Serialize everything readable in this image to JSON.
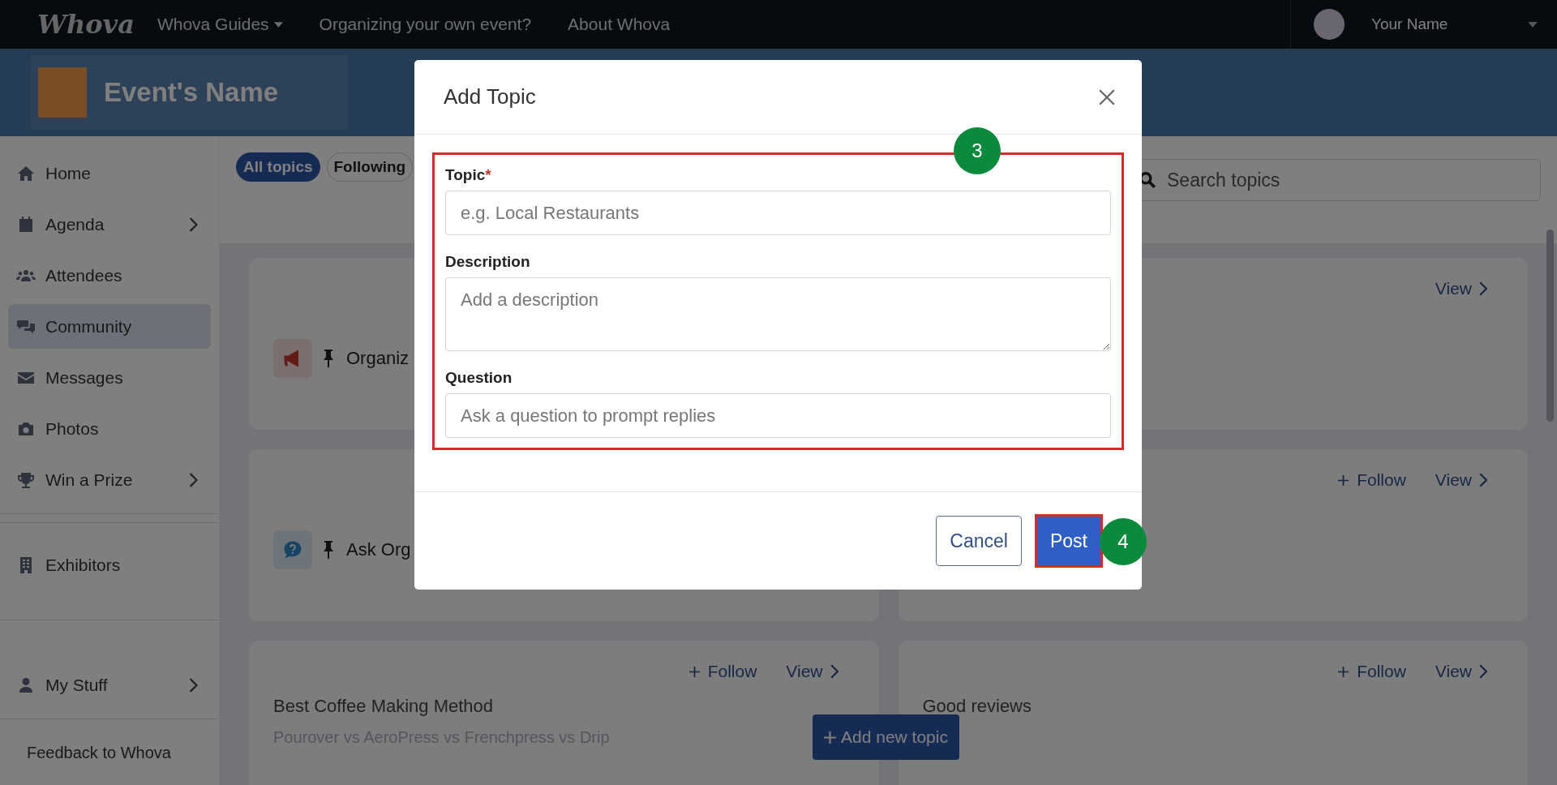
{
  "nav": {
    "logo": "Whova",
    "links": [
      {
        "label": "Whova Guides",
        "dropdown": true
      },
      {
        "label": "Organizing your own event?",
        "dropdown": false
      },
      {
        "label": "About Whova",
        "dropdown": false
      }
    ],
    "user": {
      "name": "Your Name"
    }
  },
  "event": {
    "name": "Event's Name"
  },
  "sidebar": {
    "sections": [
      {
        "items": [
          {
            "label": "Home",
            "submenu": false,
            "selected": false
          },
          {
            "label": "Agenda",
            "submenu": true,
            "selected": false
          },
          {
            "label": "Attendees",
            "submenu": false,
            "selected": false
          },
          {
            "label": "Community",
            "submenu": false,
            "selected": true
          },
          {
            "label": "Messages",
            "submenu": false,
            "selected": false
          },
          {
            "label": "Photos",
            "submenu": false,
            "selected": false
          },
          {
            "label": "Win a Prize",
            "submenu": true,
            "selected": false
          }
        ]
      },
      {
        "items": [
          {
            "label": "Exhibitors",
            "submenu": false,
            "selected": false
          }
        ]
      },
      {
        "items": [
          {
            "label": "My Stuff",
            "submenu": true,
            "selected": false
          }
        ]
      }
    ],
    "feedback": "Feedback to Whova"
  },
  "filters": [
    {
      "label": "All topics",
      "selected": true
    },
    {
      "label": "Following",
      "selected": false
    }
  ],
  "search": {
    "placeholder": "Search topics"
  },
  "cards": [
    {
      "kind": "announcement",
      "pinned": true,
      "title": "Organiz"
    },
    {
      "view": "View"
    },
    {
      "kind": "question",
      "pinned": true,
      "title": "Ask Org"
    },
    {
      "follow": "Follow",
      "view": "View"
    },
    {
      "kind": "topic",
      "pinned": false,
      "title": "Best Coffee Making Method",
      "subtitle": "Pourover vs AeroPress vs Frenchpress vs Drip",
      "follow": "Follow",
      "view": "View"
    },
    {
      "kind": "topic",
      "pinned": false,
      "title": "Good reviews",
      "follow": "Follow",
      "view": "View"
    }
  ],
  "add_button": "Add new topic",
  "modal": {
    "title": "Add Topic",
    "required_mark": "*",
    "form_highlighted": true,
    "form_step": "3",
    "fields": [
      {
        "kind": "input",
        "label": "Topic",
        "required": true,
        "placeholder": "e.g. Local Restaurants"
      },
      {
        "kind": "textarea",
        "label": "Description",
        "required": false,
        "placeholder": "Add a description"
      },
      {
        "kind": "input",
        "label": "Question",
        "required": false,
        "placeholder": "Ask a question to prompt replies"
      }
    ],
    "cancel": "Cancel",
    "post": "Post",
    "post_highlighted": true,
    "post_step": "4"
  }
}
